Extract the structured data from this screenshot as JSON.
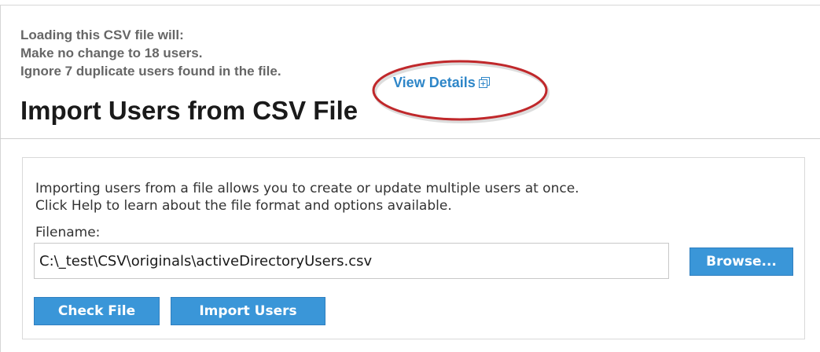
{
  "notice": {
    "lines": [
      "Loading this CSV file will:",
      "Make no change to 18 users.",
      "Ignore 7 duplicate users found in the file."
    ],
    "view_details_label": "View Details",
    "view_details_icon": "popout-icon",
    "highlight_color": "#c0282b"
  },
  "page_title": "Import Users from CSV File",
  "import_panel": {
    "intro_lines": [
      "Importing users from a file allows you to create or update multiple users at once.",
      "Click Help to learn about the file format and options available."
    ],
    "filename_label": "Filename:",
    "filename_value": "C:\\_test\\CSV\\originals\\activeDirectoryUsers.csv",
    "browse_label": "Browse...",
    "check_file_label": "Check File",
    "import_users_label": "Import Users"
  },
  "colors": {
    "link": "#2e86c8",
    "button": "#3a96d8",
    "notice_text": "#666666"
  }
}
